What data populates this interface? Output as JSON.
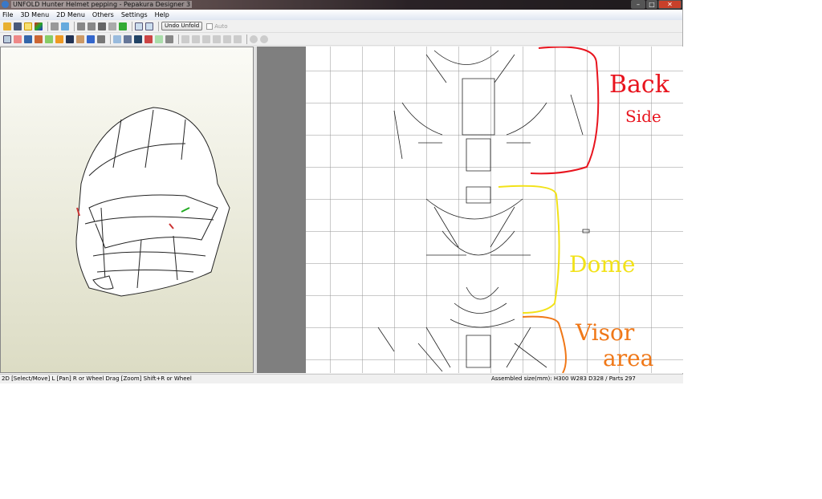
{
  "window": {
    "title": "UNFOLD Hunter Helmet pepping - Pepakura Designer 3"
  },
  "menu": [
    "File",
    "3D Menu",
    "2D Menu",
    "Others",
    "Settings",
    "Help"
  ],
  "toolbar": {
    "undo_unfold": "Undo Unfold",
    "auto": "Auto"
  },
  "status": {
    "left": "2D [Select/Move] L [Pan] R or Wheel Drag [Zoom] Shift+R or Wheel",
    "right": "Assembled size(mm): H300 W283 D328 / Parts 297"
  },
  "annotations": {
    "back": "Back",
    "side": "Side",
    "dome": "Dome",
    "visor": "Visor",
    "area": "area",
    "colors": {
      "back": "#e8141e",
      "dome": "#f2e218",
      "visor": "#f07818"
    }
  }
}
